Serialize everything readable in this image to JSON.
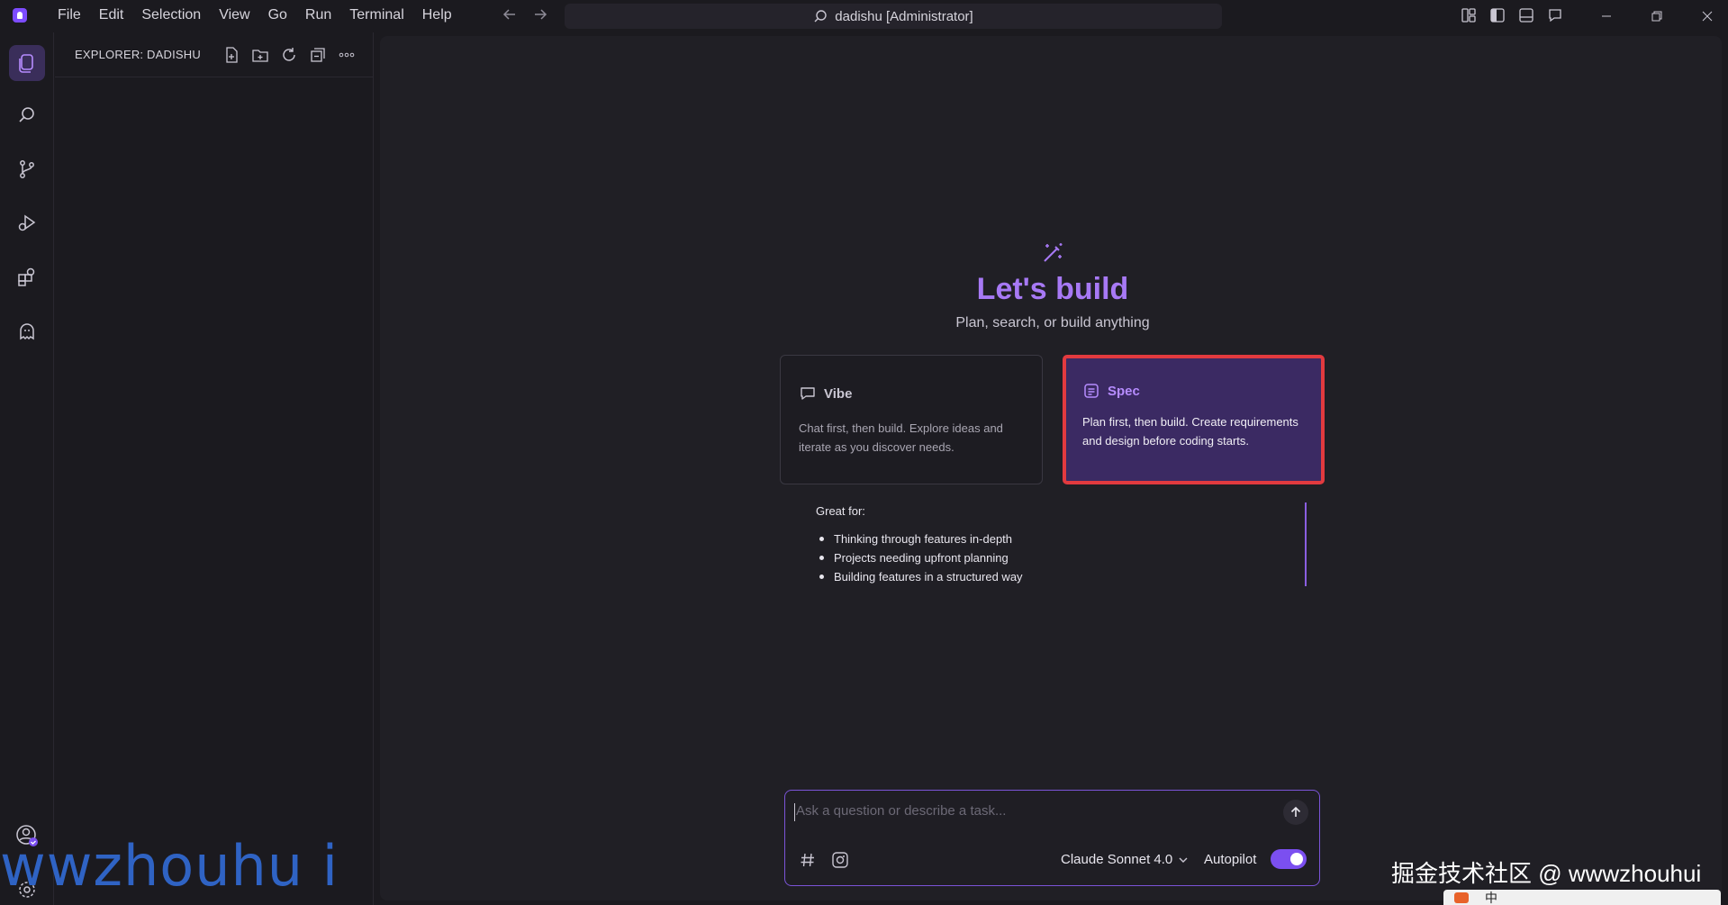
{
  "window": {
    "title": "dadishu [Administrator]",
    "menu": [
      "File",
      "Edit",
      "Selection",
      "View",
      "Go",
      "Run",
      "Terminal",
      "Help"
    ]
  },
  "sidebar": {
    "title": "EXPLORER: DADISHU"
  },
  "hero": {
    "title": "Let's build",
    "subtitle": "Plan, search, or build anything"
  },
  "modes": [
    {
      "name": "Vibe",
      "description": "Chat first, then build. Explore ideas and iterate as you discover needs.",
      "selected": false
    },
    {
      "name": "Spec",
      "description": "Plan first, then build. Create requirements and design before coding starts.",
      "selected": true
    }
  ],
  "great_for": {
    "heading": "Great for:",
    "items": [
      "Thinking through features in-depth",
      "Projects needing upfront planning",
      "Building features in a structured way"
    ]
  },
  "chat": {
    "placeholder": "Ask a question or describe a task...",
    "model": "Claude Sonnet 4.0",
    "autopilot_label": "Autopilot",
    "autopilot_on": true
  },
  "watermarks": {
    "left": "wwzhouhu i",
    "right": "掘金技术社区 @ wwwzhouhui"
  },
  "taskbar": {
    "ime": "中"
  },
  "colors": {
    "accent": "#a779f5",
    "spec_bg": "#3b2a63",
    "highlight_border": "#e23a3f",
    "background": "#1b1a1f"
  }
}
